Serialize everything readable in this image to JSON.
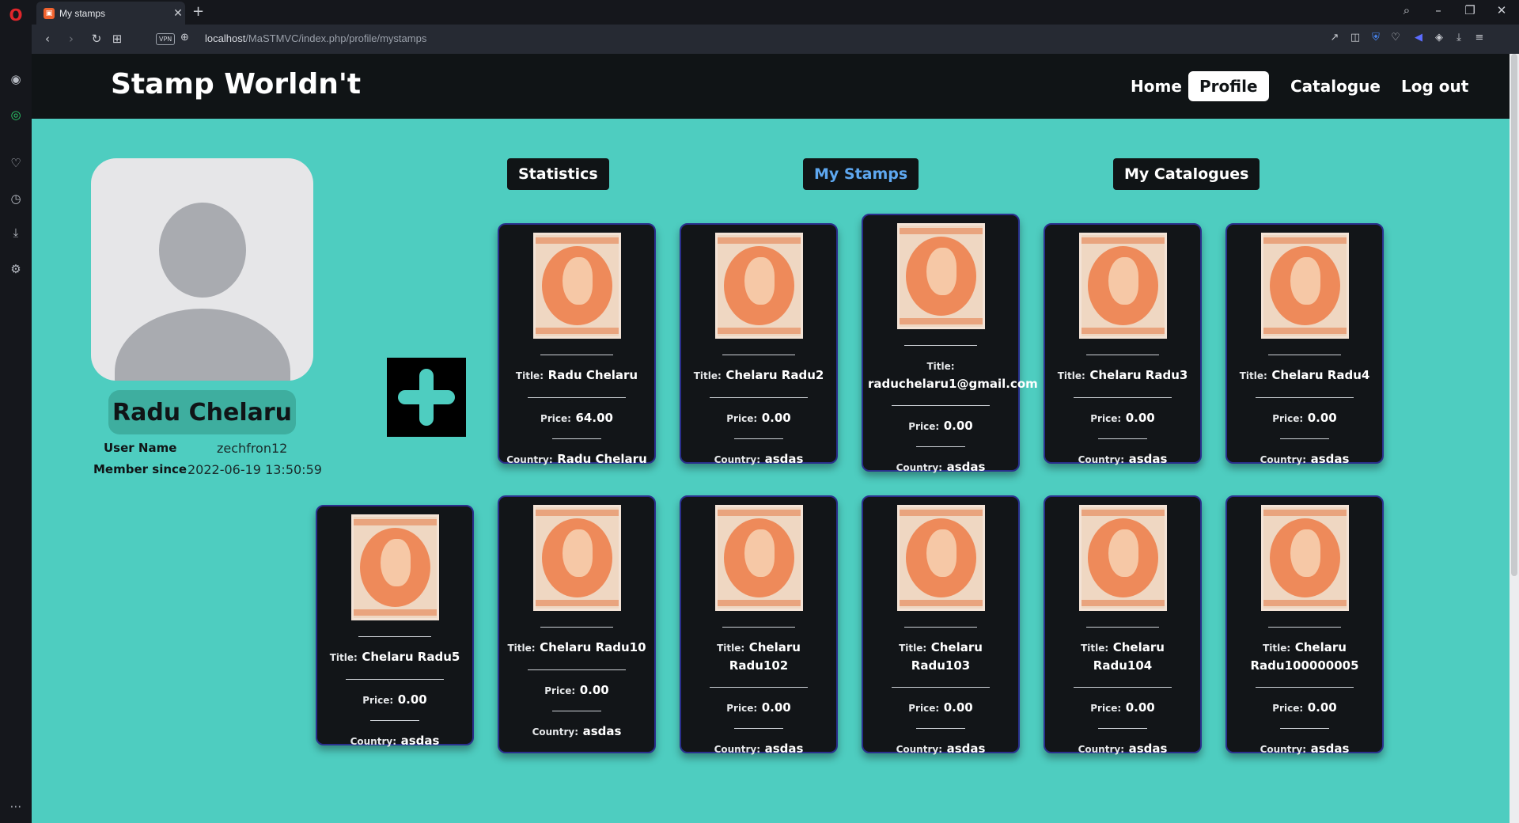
{
  "browser": {
    "tab_title": "My stamps",
    "url_host": "localhost",
    "url_path": "/MaSTMVC/index.php/profile/mystamps",
    "vpn_label": "VPN"
  },
  "site": {
    "brand": "Stamp Worldn't",
    "nav": [
      "Home",
      "Profile",
      "Catalogue",
      "Log out"
    ],
    "active_nav": "Profile"
  },
  "profile": {
    "name": "Radu Chelaru",
    "username_label": "User Name",
    "username": "zechfron12",
    "member_label": "Member since",
    "member_since": "2022-06-19 13:50:59"
  },
  "profile_tabs": [
    "Statistics",
    "My Stamps",
    "My Catalogues"
  ],
  "active_tab": "My Stamps",
  "labels": {
    "title": "Title:",
    "price": "Price:",
    "country": "Country:"
  },
  "stamps": [
    {
      "title": "Radu Chelaru",
      "price": "64.00",
      "country": "Radu Chelaru"
    },
    {
      "title": "Chelaru Radu2",
      "price": "0.00",
      "country": "asdas"
    },
    {
      "title": "raduchelaru1@gmail.com",
      "price": "0.00",
      "country": "asdas"
    },
    {
      "title": "Chelaru Radu3",
      "price": "0.00",
      "country": "asdas"
    },
    {
      "title": "Chelaru Radu4",
      "price": "0.00",
      "country": "asdas"
    },
    {
      "title": "Chelaru Radu5",
      "price": "0.00",
      "country": "asdas"
    },
    {
      "title": "Chelaru Radu10",
      "price": "0.00",
      "country": "asdas"
    },
    {
      "title": "Chelaru Radu102",
      "price": "0.00",
      "country": "asdas"
    },
    {
      "title": "Chelaru Radu103",
      "price": "0.00",
      "country": "asdas"
    },
    {
      "title": "Chelaru Radu104",
      "price": "0.00",
      "country": "asdas"
    },
    {
      "title": "Chelaru Radu100000005",
      "price": "0.00",
      "country": "asdas"
    }
  ]
}
